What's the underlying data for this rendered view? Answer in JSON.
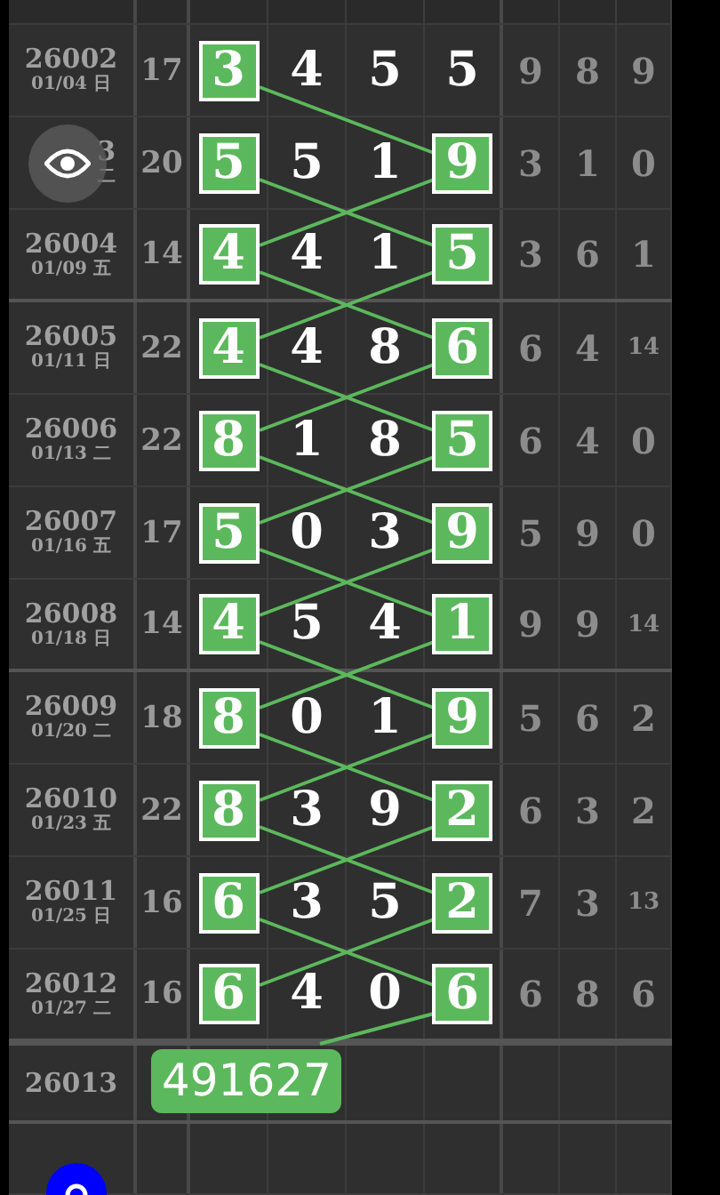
{
  "rows": [
    {
      "period": "26002",
      "date": "01/04 日",
      "sum": "17",
      "digits": [
        {
          "value": "3",
          "boxed": true
        },
        {
          "value": "4",
          "boxed": false
        },
        {
          "value": "5",
          "boxed": false
        },
        {
          "value": "5",
          "boxed": false
        }
      ],
      "extra": [
        "9",
        "8",
        "9"
      ]
    },
    {
      "period": "3",
      "date": "二",
      "obscured": true,
      "sum": "20",
      "digits": [
        {
          "value": "5",
          "boxed": true
        },
        {
          "value": "5",
          "boxed": false
        },
        {
          "value": "1",
          "boxed": false
        },
        {
          "value": "9",
          "boxed": true
        }
      ],
      "extra": [
        "3",
        "1",
        "0"
      ]
    },
    {
      "period": "26004",
      "date": "01/09 五",
      "sum": "14",
      "digits": [
        {
          "value": "4",
          "boxed": true
        },
        {
          "value": "4",
          "boxed": false
        },
        {
          "value": "1",
          "boxed": false
        },
        {
          "value": "5",
          "boxed": true
        }
      ],
      "extra": [
        "3",
        "6",
        "1"
      ]
    },
    {
      "period": "26005",
      "date": "01/11 日",
      "sum": "22",
      "digits": [
        {
          "value": "4",
          "boxed": true
        },
        {
          "value": "4",
          "boxed": false
        },
        {
          "value": "8",
          "boxed": false
        },
        {
          "value": "6",
          "boxed": true
        }
      ],
      "extra": [
        "6",
        "4",
        "14"
      ]
    },
    {
      "period": "26006",
      "date": "01/13 二",
      "sum": "22",
      "digits": [
        {
          "value": "8",
          "boxed": true
        },
        {
          "value": "1",
          "boxed": false
        },
        {
          "value": "8",
          "boxed": false
        },
        {
          "value": "5",
          "boxed": true
        }
      ],
      "extra": [
        "6",
        "4",
        "0"
      ]
    },
    {
      "period": "26007",
      "date": "01/16 五",
      "sum": "17",
      "digits": [
        {
          "value": "5",
          "boxed": true
        },
        {
          "value": "0",
          "boxed": false
        },
        {
          "value": "3",
          "boxed": false
        },
        {
          "value": "9",
          "boxed": true
        }
      ],
      "extra": [
        "5",
        "9",
        "0"
      ]
    },
    {
      "period": "26008",
      "date": "01/18 日",
      "sum": "14",
      "digits": [
        {
          "value": "4",
          "boxed": true
        },
        {
          "value": "5",
          "boxed": false
        },
        {
          "value": "4",
          "boxed": false
        },
        {
          "value": "1",
          "boxed": true
        }
      ],
      "extra": [
        "9",
        "9",
        "14"
      ]
    },
    {
      "period": "26009",
      "date": "01/20 二",
      "sum": "18",
      "digits": [
        {
          "value": "8",
          "boxed": true
        },
        {
          "value": "0",
          "boxed": false
        },
        {
          "value": "1",
          "boxed": false
        },
        {
          "value": "9",
          "boxed": true
        }
      ],
      "extra": [
        "5",
        "6",
        "2"
      ]
    },
    {
      "period": "26010",
      "date": "01/23 五",
      "sum": "22",
      "digits": [
        {
          "value": "8",
          "boxed": true
        },
        {
          "value": "3",
          "boxed": false
        },
        {
          "value": "9",
          "boxed": false
        },
        {
          "value": "2",
          "boxed": true
        }
      ],
      "extra": [
        "6",
        "3",
        "2"
      ]
    },
    {
      "period": "26011",
      "date": "01/25 日",
      "sum": "16",
      "digits": [
        {
          "value": "6",
          "boxed": true
        },
        {
          "value": "3",
          "boxed": false
        },
        {
          "value": "5",
          "boxed": false
        },
        {
          "value": "2",
          "boxed": true
        }
      ],
      "extra": [
        "7",
        "3",
        "13"
      ]
    },
    {
      "period": "26012",
      "date": "01/27 二",
      "sum": "16",
      "digits": [
        {
          "value": "6",
          "boxed": true
        },
        {
          "value": "4",
          "boxed": false
        },
        {
          "value": "0",
          "boxed": false
        },
        {
          "value": "6",
          "boxed": true
        }
      ],
      "extra": [
        "6",
        "8",
        "6"
      ]
    }
  ],
  "next": {
    "period": "26013",
    "prediction": "491627"
  }
}
